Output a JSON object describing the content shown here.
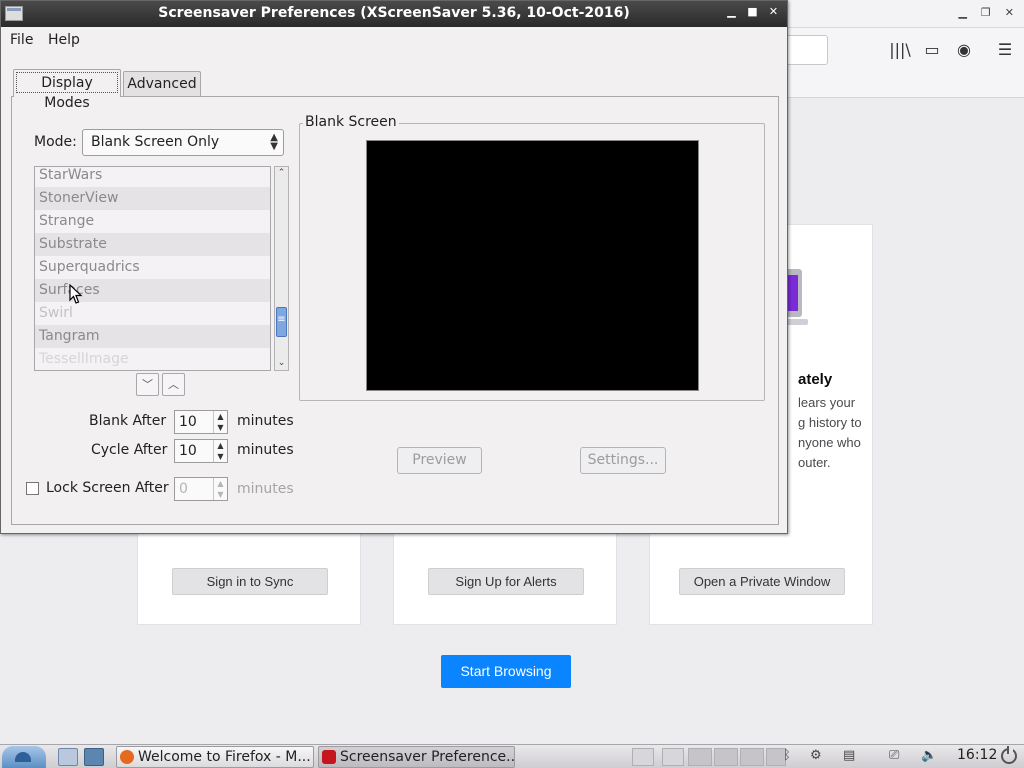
{
  "firefox": {
    "cards": [
      {
        "button": "Sign in to Sync"
      },
      {
        "button": "Sign Up for Alerts"
      },
      {
        "title": "ately",
        "text_lines": [
          "lears your",
          "g history to",
          "nyone who",
          "outer."
        ],
        "button": "Open a Private Window"
      }
    ],
    "start_button": "Start Browsing",
    "accent_color": "#0a84ff"
  },
  "dialog": {
    "title": "Screensaver Preferences  (XScreenSaver 5.36, 10-Oct-2016)",
    "window_buttons": [
      "minimize-icon",
      "maximize-icon",
      "close-icon"
    ],
    "menu": {
      "file": "File",
      "help": "Help"
    },
    "tabs": {
      "display_modes": "Display Modes",
      "advanced": "Advanced"
    },
    "mode": {
      "label": "Mode:",
      "value": "Blank Screen Only"
    },
    "hacks": [
      {
        "name": "StarWars"
      },
      {
        "name": "StonerView"
      },
      {
        "name": "Strange"
      },
      {
        "name": "Substrate"
      },
      {
        "name": "Superquadrics"
      },
      {
        "name": "Surfaces"
      },
      {
        "name": "Swirl"
      },
      {
        "name": "Tangram"
      },
      {
        "name": "TessellImage"
      }
    ],
    "blank_after": {
      "label": "Blank After",
      "value": "10",
      "unit": "minutes"
    },
    "cycle_after": {
      "label": "Cycle After",
      "value": "10",
      "unit": "minutes"
    },
    "lock_screen": {
      "label": "Lock Screen After",
      "checked": false,
      "value": "0",
      "unit": "minutes"
    },
    "preview": {
      "frame_label": "Blank Screen",
      "preview_button": "Preview",
      "settings_button": "Settings..."
    }
  },
  "taskbar": {
    "tasks": [
      {
        "label": "Welcome to Firefox - M...",
        "icon": "firefox-icon"
      },
      {
        "label": "Screensaver Preference...",
        "icon": "screensaver-icon"
      }
    ],
    "clock": "16:12"
  }
}
